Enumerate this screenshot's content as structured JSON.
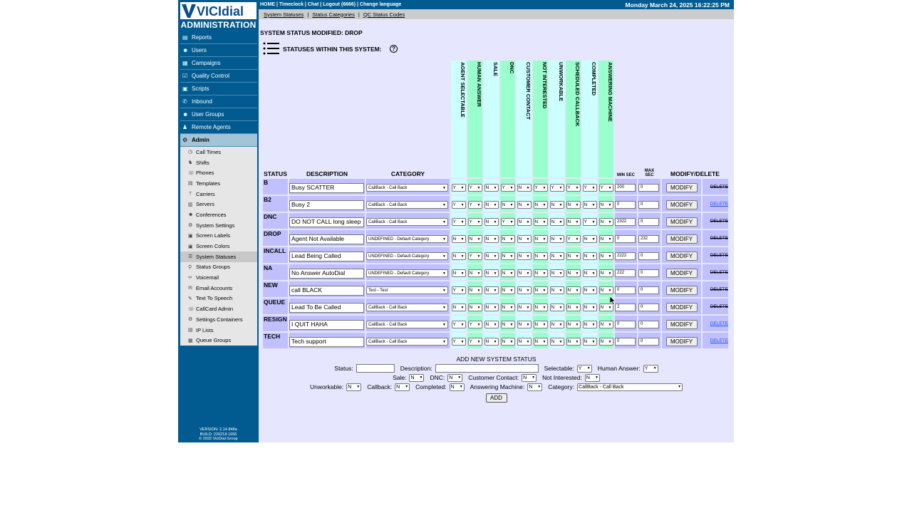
{
  "topbar": {
    "links": "HOME | Timeclock | Chat | Logout (6666) | Change language",
    "datetime": "Monday March 24, 2025 16:22:25 PM"
  },
  "subnav": [
    "System Statuses",
    "Status Categories",
    "QC Status Codes"
  ],
  "sidebar": {
    "logo": "VICIdial",
    "title": "ADMINISTRATION",
    "items": [
      {
        "label": "Reports",
        "icon": "reports-icon"
      },
      {
        "label": "Users",
        "icon": "users-icon"
      },
      {
        "label": "Campaigns",
        "icon": "campaigns-icon"
      },
      {
        "label": "Quality Control",
        "icon": "quality-control-icon"
      },
      {
        "label": "Scripts",
        "icon": "scripts-icon"
      },
      {
        "label": "Inbound",
        "icon": "inbound-icon"
      },
      {
        "label": "User Groups",
        "icon": "user-groups-icon"
      },
      {
        "label": "Remote Agents",
        "icon": "remote-agents-icon"
      },
      {
        "label": "Admin",
        "icon": "gear-icon"
      }
    ],
    "admin_sub": [
      "Call Times",
      "Shifts",
      "Phones",
      "Templates",
      "Carriers",
      "Servers",
      "Conferences",
      "System Settings",
      "Screen Labels",
      "Screen Colors",
      "System Statuses",
      "Status Groups",
      "Voicemail",
      "Email Accounts",
      "Text To Speech",
      "CallCard Admin",
      "Settings Containers",
      "IP Lists",
      "Queue Groups"
    ],
    "version": [
      "VERSION: 2.14-848a",
      "BUILD: 220218-1656",
      "© 2022 ViciDial Group"
    ]
  },
  "page": {
    "modified": "SYSTEM STATUS MODIFIED: DROP",
    "statuses_title": "STATUSES WITHIN THIS SYSTEM:",
    "help": "?"
  },
  "table": {
    "headers": {
      "status": "STATUS",
      "description": "DESCRIPTION",
      "category": "CATEGORY",
      "min_sec": "MIN SEC",
      "max_sec": "MAX SEC",
      "modify_delete": "MODIFY/DELETE",
      "flags": [
        "AGENT SELECTABLE",
        "HUMAN ANSWER",
        "SALE",
        "DNC",
        "CUSTOMER CONTACT",
        "NOT INTERESTED",
        "UNWORKABLE",
        "SCHEDULED CALLBACK",
        "COMPLETED",
        "ANSWERING MACHINE"
      ]
    },
    "modify_label": "MODIFY",
    "delete_label": "DELETE",
    "rows": [
      {
        "status": "B",
        "desc": "Busy SCATTER",
        "cat": "CallBack - Call Back",
        "flags": [
          "Y",
          "Y",
          "N",
          "Y",
          "N",
          "Y",
          "Y",
          "Y",
          "Y",
          "Y"
        ],
        "min": "200",
        "max": "0",
        "del_link": false
      },
      {
        "status": "B2",
        "desc": "Busy 2",
        "cat": "CallBack - Call Back",
        "flags": [
          "Y",
          "Y",
          "N",
          "N",
          "N",
          "N",
          "N",
          "N",
          "N",
          "N"
        ],
        "min": "0",
        "max": "0",
        "del_link": true
      },
      {
        "status": "DNC",
        "desc": "DO NOT CALL long sleep",
        "cat": "CallBack - Call Back",
        "flags": [
          "Y",
          "Y",
          "N",
          "Y",
          "N",
          "N",
          "N",
          "N",
          "Y",
          "N"
        ],
        "min": "2322",
        "max": "0",
        "del_link": false
      },
      {
        "status": "DROP",
        "desc": "Agent Not Available",
        "cat": "UNDEFINED - Default Category",
        "flags": [
          "N",
          "N",
          "N",
          "N",
          "N",
          "N",
          "N",
          "Y",
          "N",
          "N"
        ],
        "min": "0",
        "max": "232",
        "del_link": false
      },
      {
        "status": "INCALL",
        "desc": "Lead Being Called",
        "cat": "UNDEFINED - Default Category",
        "flags": [
          "N",
          "Y",
          "N",
          "N",
          "N",
          "N",
          "N",
          "N",
          "N",
          "N"
        ],
        "min": "2222",
        "max": "0",
        "del_link": false
      },
      {
        "status": "NA",
        "desc": "No Answer AutoDial",
        "cat": "UNDEFINED - Default Category",
        "flags": [
          "N",
          "N",
          "N",
          "N",
          "N",
          "N",
          "N",
          "N",
          "N",
          "N"
        ],
        "min": "222",
        "max": "0",
        "del_link": false
      },
      {
        "status": "NEW",
        "desc": "call BLACK",
        "cat": "Test - Test",
        "flags": [
          "Y",
          "N",
          "N",
          "N",
          "N",
          "N",
          "N",
          "N",
          "N",
          "N"
        ],
        "min": "0",
        "max": "0",
        "del_link": false
      },
      {
        "status": "QUEUE",
        "desc": "Lead To Be Called",
        "cat": "CallBack - Call Back",
        "flags": [
          "N",
          "N",
          "N",
          "N",
          "N",
          "N",
          "N",
          "N",
          "N",
          "N"
        ],
        "min": "2",
        "max": "0",
        "del_link": false
      },
      {
        "status": "RESIGN",
        "desc": "I QUIT HAHA",
        "cat": "CallBack - Call Back",
        "flags": [
          "Y",
          "Y",
          "N",
          "N",
          "N",
          "N",
          "N",
          "N",
          "N",
          "N"
        ],
        "min": "0",
        "max": "0",
        "del_link": true
      },
      {
        "status": "TECH",
        "desc": "Tech support",
        "cat": "CallBack - Call Back",
        "flags": [
          "Y",
          "Y",
          "N",
          "N",
          "N",
          "N",
          "N",
          "N",
          "N",
          "N"
        ],
        "min": "0",
        "max": "0",
        "del_link": true
      }
    ]
  },
  "add_form": {
    "title": "ADD NEW SYSTEM STATUS",
    "status_label": "Status:",
    "description_label": "Description:",
    "selectable_label": "Selectable:",
    "selectable": "Y",
    "human_answer_label": "Human Answer:",
    "human_answer": "Y",
    "sale_label": "Sale:",
    "sale": "N",
    "dnc_label": "DNC:",
    "dnc": "N",
    "customer_contact_label": "Customer Contact:",
    "customer_contact": "N",
    "not_interested_label": "Not Interested:",
    "not_interested": "N",
    "unworkable_label": "Unworkable:",
    "unworkable": "N",
    "callback_label": "Callback:",
    "callback": "N",
    "completed_label": "Completed:",
    "completed": "N",
    "answering_machine_label": "Answering Machine:",
    "answering_machine": "N",
    "category_label": "Category:",
    "category": "CallBack - Call Back",
    "add_button": "ADD"
  }
}
